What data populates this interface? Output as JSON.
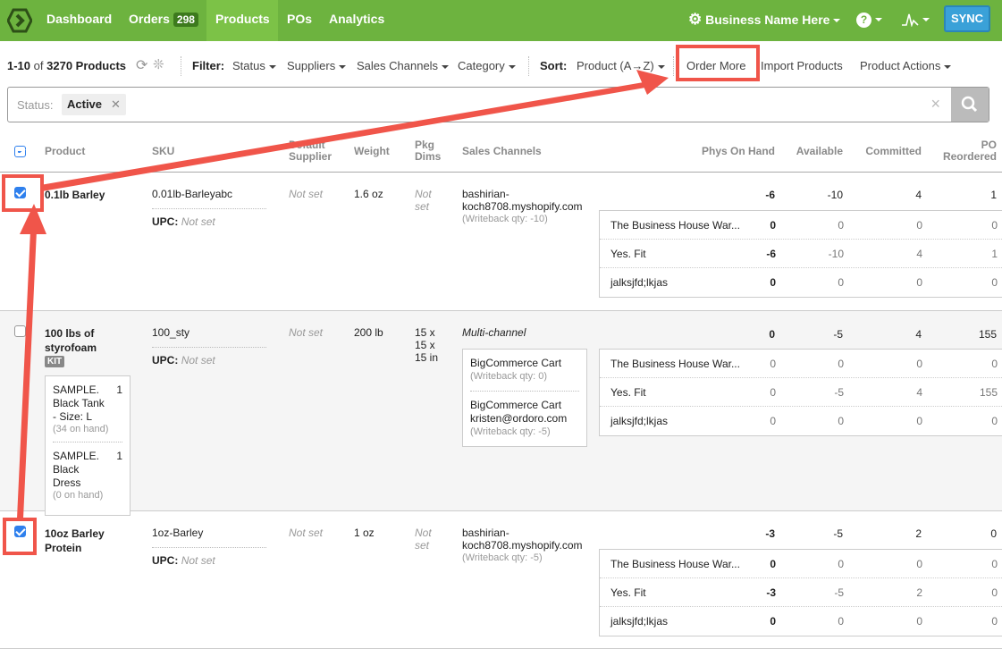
{
  "nav": {
    "items": [
      {
        "label": "Dashboard"
      },
      {
        "label": "Orders",
        "badge": "298"
      },
      {
        "label": "Products"
      },
      {
        "label": "POs"
      },
      {
        "label": "Analytics"
      }
    ],
    "business": "Business Name Here",
    "sync": "SYNC",
    "active": "Products"
  },
  "toolbar": {
    "range": "1-10",
    "of": "of",
    "total": "3270 Products",
    "filter_label": "Filter:",
    "filters": [
      "Status",
      "Suppliers",
      "Sales Channels",
      "Category"
    ],
    "sort_label": "Sort:",
    "sort_value": "Product (A→Z)",
    "order_more": "Order More",
    "import": "Import Products",
    "actions": "Product Actions"
  },
  "search": {
    "status_label": "Status:",
    "status_value": "Active",
    "clear": "×"
  },
  "columns": [
    "Product",
    "SKU",
    "Default Supplier",
    "Weight",
    "Pkg Dims",
    "Sales Channels",
    "Phys On Hand",
    "Available",
    "Committed",
    "PO Reordered"
  ],
  "rows": [
    {
      "checked": true,
      "name": "0.1lb Barley",
      "sku": "0.01lb-Barleyabc",
      "upc_label": "UPC:",
      "upc": "Not set",
      "supplier": "Not set",
      "weight": "1.6 oz",
      "dims": "Not set",
      "channel": "bashirian-koch8708.myshopify.com",
      "writeback": "(Writeback qty: -10)",
      "totals": [
        "-6",
        "-10",
        "4",
        "1"
      ],
      "warehouses": [
        {
          "name": "The Business House War...",
          "v": [
            "0",
            "0",
            "0",
            "0"
          ]
        },
        {
          "name": "Yes. Fit",
          "v": [
            "-6",
            "-10",
            "4",
            "1"
          ]
        },
        {
          "name": "jalksjfd;lkjas",
          "v": [
            "0",
            "0",
            "0",
            "0"
          ]
        }
      ]
    },
    {
      "checked": false,
      "name": "100 lbs of styrofoam",
      "kit": "KIT",
      "sku": "100_sty",
      "upc_label": "UPC:",
      "upc": "Not set",
      "supplier": "Not set",
      "weight": "200 lb",
      "dims": "15 x 15 x 15 in",
      "channel": "Multi-channel",
      "channels": [
        {
          "name": "BigCommerce Cart",
          "writeback": "(Writeback qty: 0)"
        },
        {
          "name": "BigCommerce Cart kristen@ordoro.com",
          "writeback": "(Writeback qty: -5)"
        }
      ],
      "components": [
        {
          "name": "SAMPLE. Black Tank - Size: L",
          "qty": "1",
          "onhand": "(34 on hand)"
        },
        {
          "name": "SAMPLE. Black Dress",
          "qty": "1",
          "onhand": "(0 on hand)"
        }
      ],
      "totals": [
        "0",
        "-5",
        "4",
        "155"
      ],
      "warehouses": [
        {
          "name": "The Business House War...",
          "v": [
            "0",
            "0",
            "0",
            "0"
          ]
        },
        {
          "name": "Yes. Fit",
          "v": [
            "0",
            "-5",
            "4",
            "155"
          ]
        },
        {
          "name": "jalksjfd;lkjas",
          "v": [
            "0",
            "0",
            "0",
            "0"
          ]
        }
      ]
    },
    {
      "checked": true,
      "name": "10oz Barley Protein",
      "sku": "1oz-Barley",
      "upc_label": "UPC:",
      "upc": "Not set",
      "supplier": "Not set",
      "weight": "1 oz",
      "dims": "Not set",
      "channel": "bashirian-koch8708.myshopify.com",
      "writeback": "(Writeback qty: -5)",
      "totals": [
        "-3",
        "-5",
        "2",
        "0"
      ],
      "warehouses": [
        {
          "name": "The Business House War...",
          "v": [
            "0",
            "0",
            "0",
            "0"
          ]
        },
        {
          "name": "Yes. Fit",
          "v": [
            "-3",
            "-5",
            "2",
            "0"
          ]
        },
        {
          "name": "jalksjfd;lkjas",
          "v": [
            "0",
            "0",
            "0",
            "0"
          ]
        }
      ]
    }
  ],
  "colors": {
    "nav": "#6db33f",
    "sync": "#3aa1d8",
    "annotation": "#f0554a",
    "checkbox": "#2f80ed"
  }
}
